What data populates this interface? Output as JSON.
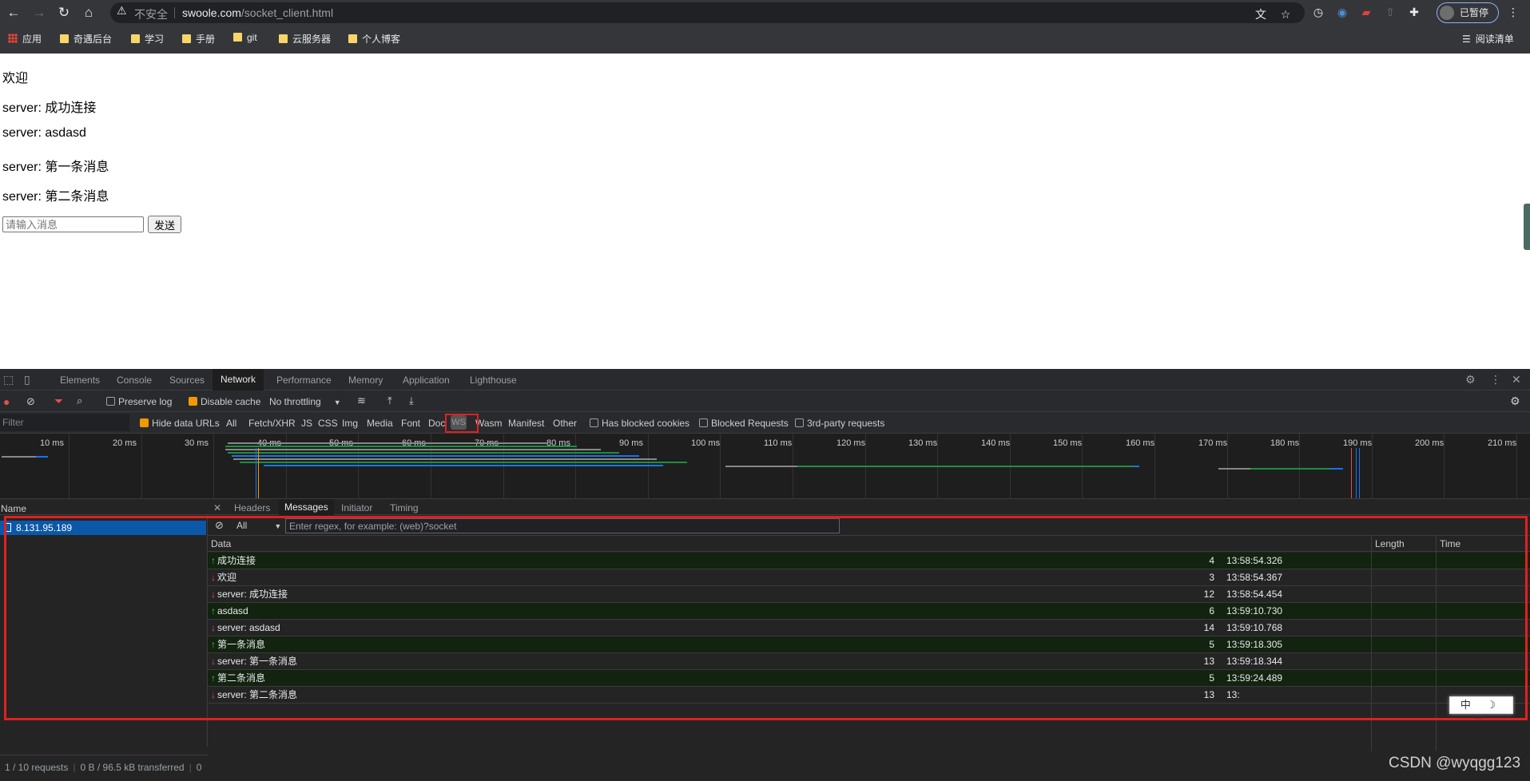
{
  "browser": {
    "address": {
      "security_label": "不安全",
      "host": "swoole.com",
      "path": "/socket_client.html"
    },
    "profile_status": "已暂停",
    "bookmarks": {
      "apps": "应用",
      "items": [
        "奇遇后台",
        "学习",
        "手册",
        "git",
        "云服务器",
        "个人博客"
      ],
      "reading_list": "阅读清单"
    }
  },
  "page": {
    "lines": [
      "欢迎",
      "server: 成功连接",
      "server: asdasd",
      "server: 第一条消息",
      "server: 第二条消息"
    ],
    "input_placeholder": "请输入消息",
    "send_label": "发送"
  },
  "devtools": {
    "tabs": [
      "Elements",
      "Console",
      "Sources",
      "Network",
      "Performance",
      "Memory",
      "Application",
      "Lighthouse"
    ],
    "active_tab": "Network",
    "toolbar": {
      "preserve_log": "Preserve log",
      "disable_cache": "Disable cache",
      "throttling": "No throttling"
    },
    "filter_bar": {
      "placeholder": "Filter",
      "hide_data_urls": "Hide data URLs",
      "types": [
        "All",
        "Fetch/XHR",
        "JS",
        "CSS",
        "Img",
        "Media",
        "Font",
        "Doc",
        "WS",
        "Wasm",
        "Manifest",
        "Other"
      ],
      "has_blocked_cookies": "Has blocked cookies",
      "blocked_requests": "Blocked Requests",
      "third_party": "3rd-party requests"
    },
    "timeline_ticks": [
      "10 ms",
      "20 ms",
      "30 ms",
      "40 ms",
      "50 ms",
      "60 ms",
      "70 ms",
      "80 ms",
      "90 ms",
      "100 ms",
      "110 ms",
      "120 ms",
      "130 ms",
      "140 ms",
      "150 ms",
      "160 ms",
      "170 ms",
      "180 ms",
      "190 ms",
      "200 ms",
      "210 ms"
    ],
    "requests": {
      "header": "Name",
      "selected": "8.131.95.189",
      "footer": "1 / 10 requests",
      "footer_transfer": "0 B / 96.5 kB transferred",
      "footer_extra": "0"
    },
    "detail_tabs": [
      "Headers",
      "Messages",
      "Initiator",
      "Timing"
    ],
    "active_detail_tab": "Messages",
    "messages_filter": {
      "type": "All",
      "placeholder": "Enter regex, for example: (web)?socket"
    },
    "columns": {
      "data": "Data",
      "length": "Length",
      "time": "Time"
    },
    "messages": [
      {
        "dir": "sent",
        "data": "成功连接",
        "length": "4",
        "time": "13:58:54.326"
      },
      {
        "dir": "recv",
        "data": "欢迎",
        "length": "3",
        "time": "13:58:54.367"
      },
      {
        "dir": "recv",
        "data": "server: 成功连接",
        "length": "12",
        "time": "13:58:54.454"
      },
      {
        "dir": "sent",
        "data": "asdasd",
        "length": "6",
        "time": "13:59:10.730"
      },
      {
        "dir": "recv",
        "data": "server: asdasd",
        "length": "14",
        "time": "13:59:10.768"
      },
      {
        "dir": "sent",
        "data": "第一条消息",
        "length": "5",
        "time": "13:59:18.305"
      },
      {
        "dir": "recv",
        "data": "server: 第一条消息",
        "length": "13",
        "time": "13:59:18.344"
      },
      {
        "dir": "sent",
        "data": "第二条消息",
        "length": "5",
        "time": "13:59:24.489"
      },
      {
        "dir": "recv",
        "data": "server: 第二条消息",
        "length": "13",
        "time": "13:"
      }
    ]
  },
  "ime": "中 ☽ ⺌",
  "watermark": "CSDN @wyqgg123"
}
